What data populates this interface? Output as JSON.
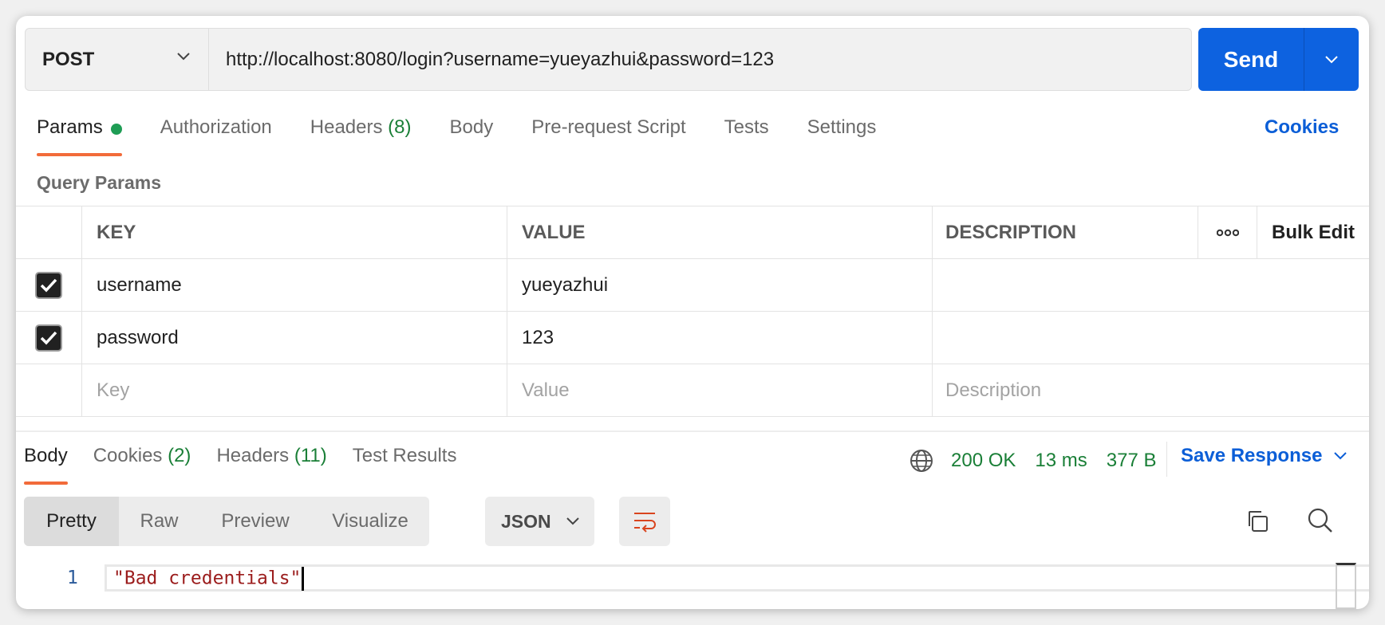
{
  "request": {
    "method": "POST",
    "url": "http://localhost:8080/login?username=yueyazhui&password=123",
    "send_label": "Send"
  },
  "tabs": [
    {
      "label": "Params",
      "count": ""
    },
    {
      "label": "Authorization",
      "count": ""
    },
    {
      "label": "Headers",
      "count": "(8)"
    },
    {
      "label": "Body",
      "count": ""
    },
    {
      "label": "Pre-request Script",
      "count": ""
    },
    {
      "label": "Tests",
      "count": ""
    },
    {
      "label": "Settings",
      "count": ""
    }
  ],
  "cookies_link": "Cookies",
  "query_params_title": "Query Params",
  "params_table": {
    "headers": {
      "key": "KEY",
      "value": "VALUE",
      "description": "DESCRIPTION",
      "more": "∘∘∘",
      "bulk_edit": "Bulk Edit"
    },
    "rows": [
      {
        "key": "username",
        "value": "yueyazhui",
        "description": "",
        "checked": true
      },
      {
        "key": "password",
        "value": "123",
        "description": "",
        "checked": true
      }
    ],
    "placeholders": {
      "key": "Key",
      "value": "Value",
      "description": "Description"
    }
  },
  "response": {
    "tabs": [
      {
        "label": "Body",
        "count": ""
      },
      {
        "label": "Cookies",
        "count": "(2)"
      },
      {
        "label": "Headers",
        "count": "(11)"
      },
      {
        "label": "Test Results",
        "count": ""
      }
    ],
    "status": "200 OK",
    "time": "13 ms",
    "size": "377 B",
    "save_response": "Save Response",
    "views": [
      "Pretty",
      "Raw",
      "Preview",
      "Visualize"
    ],
    "format": "JSON",
    "line_number": "1",
    "body_text": "\"Bad credentials\""
  },
  "colors": {
    "accent": "#0d62e0",
    "tab_underline": "#f26b3a",
    "status_green": "#1a7f37"
  }
}
